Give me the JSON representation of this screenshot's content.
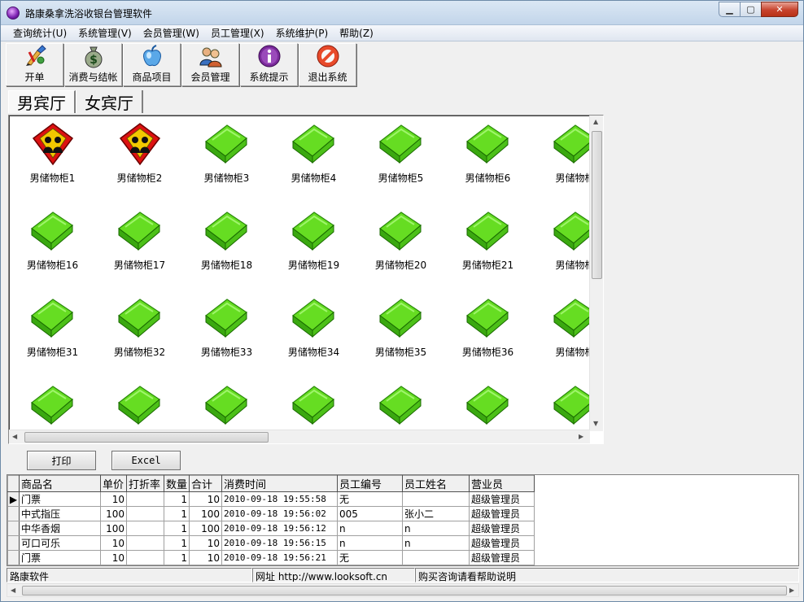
{
  "window": {
    "title": "路康桑拿洗浴收银台管理软件",
    "min_glyph": "▁",
    "max_glyph": "▢",
    "close_glyph": "✕"
  },
  "menu": [
    "查询统计(U)",
    "系统管理(V)",
    "会员管理(W)",
    "员工管理(X)",
    "系统维护(P)",
    "帮助(Z)"
  ],
  "toolbar": [
    {
      "label": "开单",
      "icon": "brush-icon"
    },
    {
      "label": "消费与结帐",
      "icon": "money-bag-icon"
    },
    {
      "label": "商品项目",
      "icon": "apple-icon"
    },
    {
      "label": "会员管理",
      "icon": "members-icon"
    },
    {
      "label": "系统提示",
      "icon": "info-icon"
    },
    {
      "label": "退出系统",
      "icon": "exit-icon"
    }
  ],
  "tabs": [
    "男宾厅",
    "女宾厅"
  ],
  "lockers": [
    {
      "name": "男储物柜1",
      "status": "occupied"
    },
    {
      "name": "男储物柜2",
      "status": "occupied"
    },
    {
      "name": "男储物柜3",
      "status": "free"
    },
    {
      "name": "男储物柜4",
      "status": "free"
    },
    {
      "name": "男储物柜5",
      "status": "free"
    },
    {
      "name": "男储物柜6",
      "status": "free"
    },
    {
      "name": "男储物柜",
      "status": "free"
    },
    {
      "name": "男储物柜16",
      "status": "free"
    },
    {
      "name": "男储物柜17",
      "status": "free"
    },
    {
      "name": "男储物柜18",
      "status": "free"
    },
    {
      "name": "男储物柜19",
      "status": "free"
    },
    {
      "name": "男储物柜20",
      "status": "free"
    },
    {
      "name": "男储物柜21",
      "status": "free"
    },
    {
      "name": "男储物柜",
      "status": "free"
    },
    {
      "name": "男储物柜31",
      "status": "free"
    },
    {
      "name": "男储物柜32",
      "status": "free"
    },
    {
      "name": "男储物柜33",
      "status": "free"
    },
    {
      "name": "男储物柜34",
      "status": "free"
    },
    {
      "name": "男储物柜35",
      "status": "free"
    },
    {
      "name": "男储物柜36",
      "status": "free"
    },
    {
      "name": "男储物柜",
      "status": "free"
    },
    {
      "name": "",
      "status": "free"
    },
    {
      "name": "",
      "status": "free"
    },
    {
      "name": "",
      "status": "free"
    },
    {
      "name": "",
      "status": "free"
    },
    {
      "name": "",
      "status": "free"
    },
    {
      "name": "",
      "status": "free"
    },
    {
      "name": "",
      "status": "free"
    }
  ],
  "buttons": {
    "print": "打印",
    "excel": "Excel"
  },
  "table": {
    "columns": [
      "商品名",
      "单价",
      "打折率",
      "数量",
      "合计",
      "消费时间",
      "员工编号",
      "员工姓名",
      "营业员"
    ],
    "rows": [
      [
        "门票",
        "10",
        "",
        "1",
        "10",
        "2010-09-18 19:55:58",
        "无",
        "",
        "超级管理员"
      ],
      [
        "中式指压",
        "100",
        "",
        "1",
        "100",
        "2010-09-18 19:56:02",
        "005",
        "张小二",
        "超级管理员"
      ],
      [
        "中华香烟",
        "100",
        "",
        "1",
        "100",
        "2010-09-18 19:56:12",
        "n",
        "n",
        "超级管理员"
      ],
      [
        "可口可乐",
        "10",
        "",
        "1",
        "10",
        "2010-09-18 19:56:15",
        "n",
        "n",
        "超级管理员"
      ],
      [
        "门票",
        "10",
        "",
        "1",
        "10",
        "2010-09-18 19:56:21",
        "无",
        "",
        "超级管理员"
      ]
    ],
    "current_row_marker": "▶"
  },
  "status": {
    "company": "路康软件",
    "website": "网址 http://www.looksoft.cn",
    "purchase": "购买咨询请看帮助说明"
  },
  "colors": {
    "free_locker": "#66dd22",
    "occupied_locker": "#dd1111",
    "accent": "#2a6ebb"
  }
}
